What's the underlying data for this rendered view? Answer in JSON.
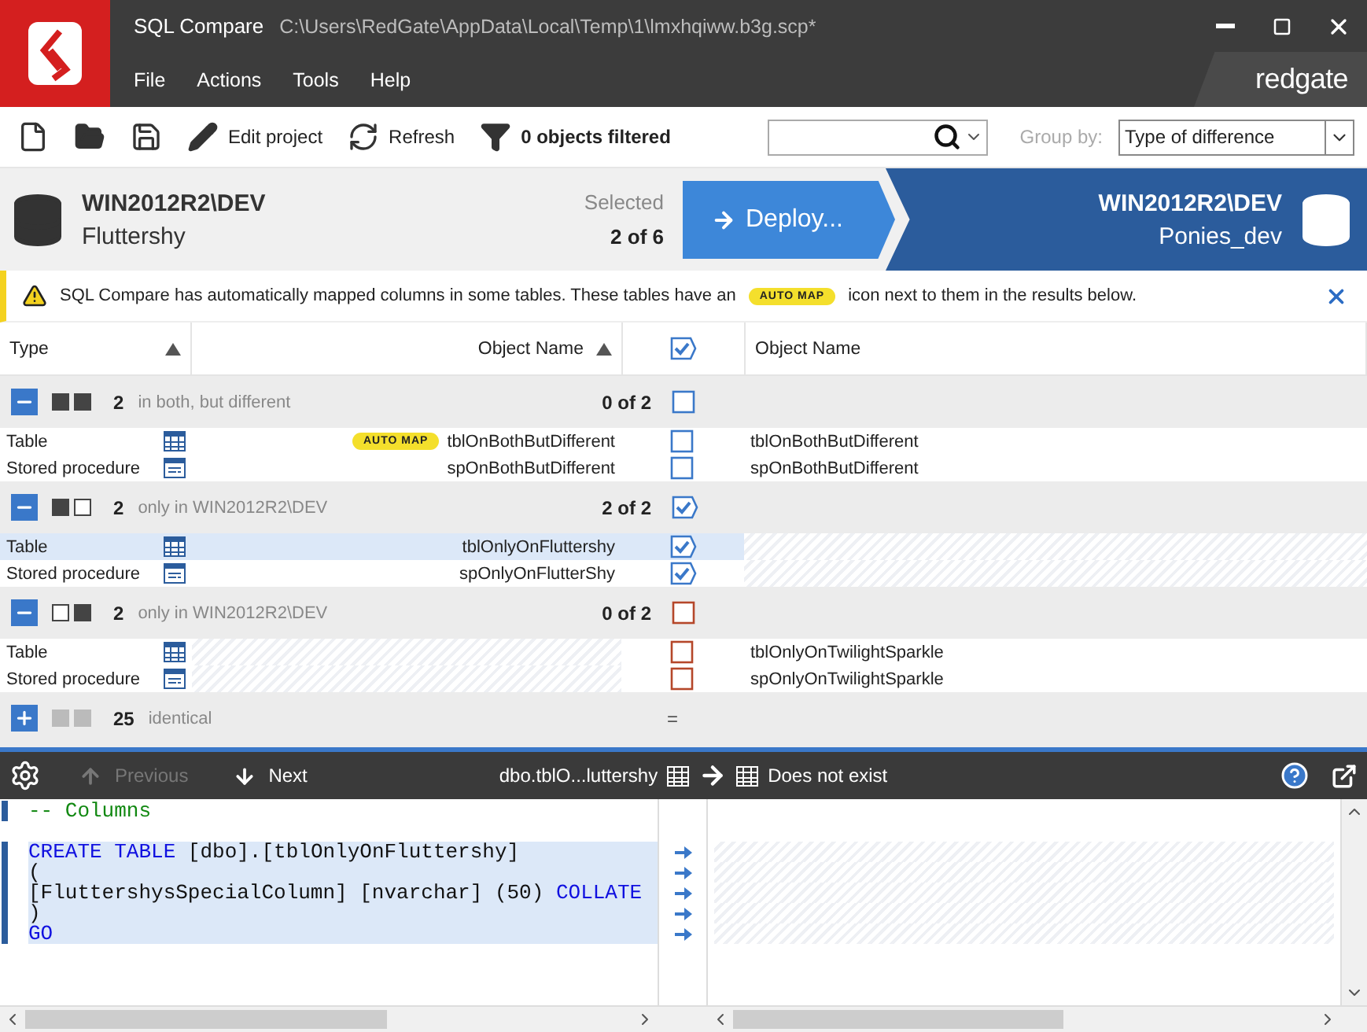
{
  "window": {
    "title": "SQL Compare",
    "path": "C:\\Users\\RedGate\\AppData\\Local\\Temp\\1\\lmxhqiww.b3g.scp*",
    "brand": "redgate"
  },
  "menu": [
    "File",
    "Actions",
    "Tools",
    "Help"
  ],
  "toolbar": [
    {
      "kind": "new"
    },
    {
      "kind": "open"
    },
    {
      "kind": "save"
    },
    {
      "kind": "edit",
      "label": "Edit project"
    },
    {
      "kind": "refresh",
      "label": "Refresh"
    },
    {
      "kind": "filter",
      "label": "0 objects filtered"
    }
  ],
  "group_by": {
    "label": "Group by:",
    "value": "Type of difference"
  },
  "source": {
    "server": "WIN2012R2\\DEV",
    "database": "Fluttershy"
  },
  "selection": {
    "label": "Selected",
    "count": "2 of 6"
  },
  "deploy": {
    "label": "Deploy..."
  },
  "target": {
    "server": "WIN2012R2\\DEV",
    "database": "Ponies_dev"
  },
  "notice": {
    "before": "SQL Compare has automatically mapped columns in some tables. These tables have an",
    "badge": "AUTO MAP",
    "after": "icon next to them in the results below."
  },
  "select_all": {
    "checked": true
  },
  "columns": [
    {
      "label": "Type",
      "sorted": true
    },
    {
      "label": "Object Name",
      "sorted": true
    },
    {
      "label": "Object Name",
      "sorted": false
    }
  ],
  "groups": [
    {
      "kind": "both",
      "expanded": true,
      "count": "2",
      "label": "in both, but different",
      "summary": "0 of 2",
      "checked": false,
      "items": [
        {
          "type": "Table",
          "kind": "table",
          "left": "tblOnBothButDifferent",
          "right": "tblOnBothButDifferent",
          "badge": "AUTO MAP",
          "checked": false,
          "selected": false
        },
        {
          "type": "Stored procedure",
          "kind": "procedure",
          "left": "spOnBothButDifferent",
          "right": "spOnBothButDifferent",
          "checked": false,
          "selected": false
        }
      ]
    },
    {
      "kind": "left",
      "expanded": true,
      "count": "2",
      "label": "only in WIN2012R2\\DEV",
      "summary": "2 of 2",
      "checked": true,
      "items": [
        {
          "type": "Table",
          "kind": "table",
          "left": "tblOnlyOnFluttershy",
          "checked": true,
          "selected": true
        },
        {
          "type": "Stored procedure",
          "kind": "procedure",
          "left": "spOnlyOnFlutterShy",
          "checked": true,
          "selected": false
        }
      ]
    },
    {
      "kind": "right",
      "expanded": true,
      "count": "2",
      "label": "only in WIN2012R2\\DEV",
      "summary": "0 of 2",
      "checked": false,
      "items": [
        {
          "type": "Table",
          "kind": "table",
          "right": "tblOnlyOnTwilightSparkle",
          "checked": false,
          "selected": false
        },
        {
          "type": "Stored procedure",
          "kind": "procedure",
          "right": "spOnlyOnTwilightSparkle",
          "checked": false,
          "selected": false
        }
      ]
    },
    {
      "kind": "identical",
      "expanded": false,
      "count": "25",
      "label": "identical",
      "summary": "="
    }
  ],
  "detail": {
    "previous": {
      "label": "Previous",
      "disabled": true
    },
    "next": {
      "label": "Next",
      "disabled": false
    },
    "left_object": "dbo.tblO...luttershy",
    "right_object": "Does not exist"
  },
  "code": [
    {
      "marker": true,
      "changed": false,
      "tokens": [
        {
          "kind": "comment",
          "t": "-- Columns"
        }
      ]
    },
    {
      "marker": false,
      "changed": false
    },
    {
      "marker": true,
      "changed": true,
      "tokens": [
        {
          "kind": "keyword",
          "t": "CREATE TABLE"
        },
        {
          "kind": "plain",
          "t": " [dbo].[tblOnlyOnFluttershy]"
        }
      ]
    },
    {
      "marker": true,
      "changed": true,
      "tokens": [
        {
          "kind": "plain",
          "t": "("
        }
      ]
    },
    {
      "marker": true,
      "changed": true,
      "tokens": [
        {
          "kind": "plain",
          "t": "[FluttershysSpecialColumn] [nvarchar] (50) "
        },
        {
          "kind": "keyword",
          "t": "COLLATE"
        }
      ]
    },
    {
      "marker": true,
      "changed": true,
      "tokens": [
        {
          "kind": "plain",
          "t": ")"
        }
      ]
    },
    {
      "marker": true,
      "changed": true,
      "tokens": [
        {
          "kind": "keyword",
          "t": "GO"
        }
      ]
    }
  ]
}
